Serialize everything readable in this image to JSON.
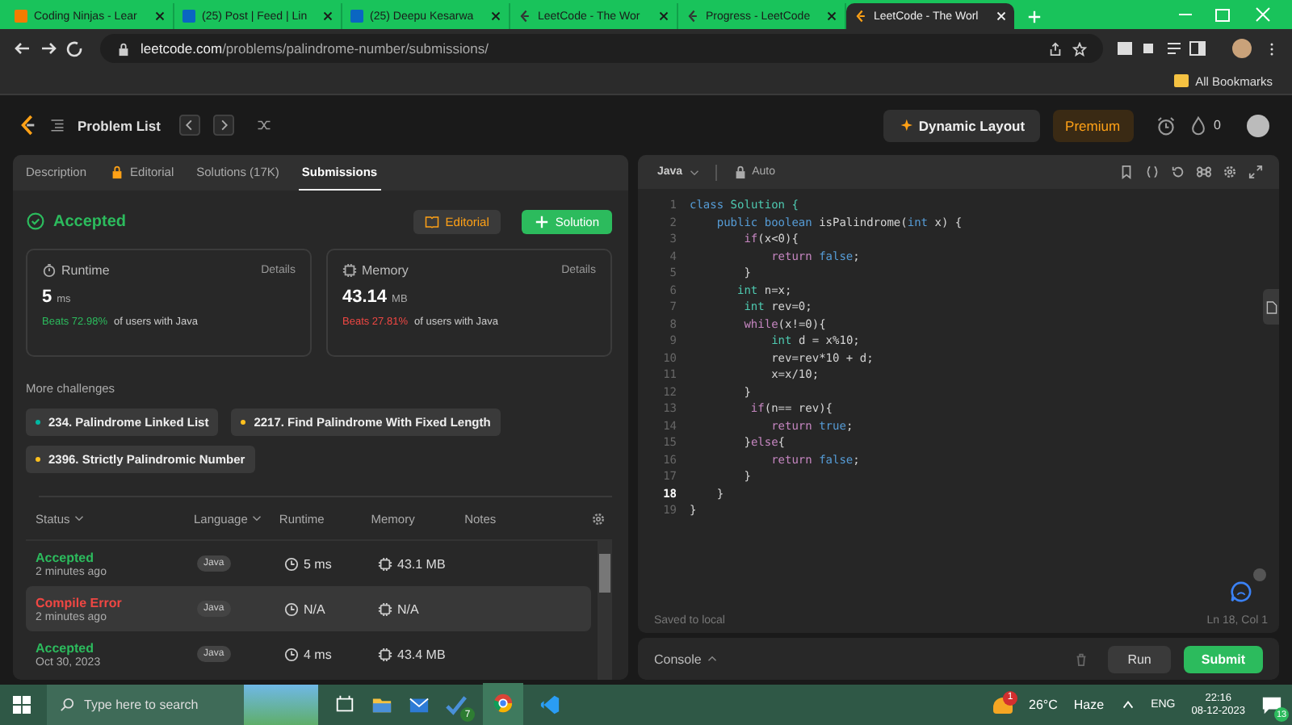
{
  "browser": {
    "tabs": [
      {
        "title": "Coding Ninjas - Lear",
        "kind": "ninja",
        "selected": false
      },
      {
        "title": "(25) Post | Feed | Lin",
        "kind": "linkedin",
        "selected": false
      },
      {
        "title": "(25) Deepu Kesarwa",
        "kind": "linkedin",
        "selected": false
      },
      {
        "title": "LeetCode - The Wor",
        "kind": "leetcode",
        "selected": false
      },
      {
        "title": "Progress - LeetCode",
        "kind": "leetcode",
        "selected": false
      },
      {
        "title": "LeetCode - The Worl",
        "kind": "leetcode",
        "selected": true
      }
    ],
    "url_host": "leetcode.com",
    "url_path": "/problems/palindrome-number/submissions/",
    "bookmarks": "All Bookmarks"
  },
  "header": {
    "problem_list": "Problem List",
    "dynamic_layout": "Dynamic Layout",
    "premium": "Premium",
    "streak": "0"
  },
  "left_tabs": [
    {
      "label": "Description",
      "selected": false
    },
    {
      "label": "Editorial",
      "selected": false
    },
    {
      "label": "Solutions (17K)",
      "selected": false
    },
    {
      "label": "Submissions",
      "selected": true
    }
  ],
  "result": {
    "status": "Accepted",
    "editorial_button": "Editorial",
    "solution_button": "Solution"
  },
  "stats": [
    {
      "title": "Runtime",
      "details": "Details",
      "value": "5",
      "unit": "ms",
      "beats": "Beats 72.98%",
      "kind": "good",
      "suffix": "of users with Java"
    },
    {
      "title": "Memory",
      "details": "Details",
      "value": "43.14",
      "unit": "MB",
      "beats": "Beats 27.81%",
      "kind": "poor",
      "suffix": "of users with Java"
    }
  ],
  "more_challenges": {
    "title": "More challenges",
    "items": [
      {
        "label": "234. Palindrome Linked List",
        "color": "#00b8a3"
      },
      {
        "label": "2217. Find Palindrome With Fixed Length",
        "color": "#ffc01e"
      },
      {
        "label": "2396. Strictly Palindromic Number",
        "color": "#ffc01e"
      }
    ]
  },
  "table": {
    "columns": [
      "Status",
      "Language",
      "Runtime",
      "Memory",
      "Notes"
    ],
    "rows": [
      {
        "status": "Accepted",
        "kind": "accepted",
        "time": "2 minutes ago",
        "language": "Java",
        "runtime": "5 ms",
        "memory": "43.1 MB",
        "selected": false
      },
      {
        "status": "Compile Error",
        "kind": "error",
        "time": "2 minutes ago",
        "language": "Java",
        "runtime": "N/A",
        "memory": "N/A",
        "selected": true
      },
      {
        "status": "Accepted",
        "kind": "accepted",
        "time": "Oct 30, 2023",
        "language": "Java",
        "runtime": "4 ms",
        "memory": "43.4 MB",
        "selected": false
      }
    ]
  },
  "editor": {
    "language": "Java",
    "mode": "Auto",
    "code": [
      {
        "number": "1",
        "selected": false,
        "tokens": [
          {
            "text": "class ",
            "kind": "keyword"
          },
          {
            "text": "Solution {",
            "kind": "type"
          }
        ]
      },
      {
        "number": "2",
        "selected": false,
        "tokens": [
          {
            "text": "    public ",
            "kind": "keyword"
          },
          {
            "text": "boolean ",
            "kind": "keyword"
          },
          {
            "text": "isPalindrome(",
            "kind": "plain"
          },
          {
            "text": "int ",
            "kind": "keyword"
          },
          {
            "text": "x) {",
            "kind": "plain"
          }
        ]
      },
      {
        "number": "3",
        "selected": false,
        "tokens": [
          {
            "text": "        if",
            "kind": "control"
          },
          {
            "text": "(x<0){",
            "kind": "plain"
          }
        ]
      },
      {
        "number": "4",
        "selected": false,
        "tokens": [
          {
            "text": "            return ",
            "kind": "control"
          },
          {
            "text": "false",
            "kind": "keyword"
          },
          {
            "text": ";",
            "kind": "plain"
          }
        ]
      },
      {
        "number": "5",
        "selected": false,
        "tokens": [
          {
            "text": "        }",
            "kind": "plain"
          }
        ]
      },
      {
        "number": "6",
        "selected": false,
        "tokens": [
          {
            "text": "       int ",
            "kind": "type"
          },
          {
            "text": "n=x;",
            "kind": "plain"
          }
        ]
      },
      {
        "number": "7",
        "selected": false,
        "tokens": [
          {
            "text": "        int ",
            "kind": "type"
          },
          {
            "text": "rev=0;",
            "kind": "plain"
          }
        ]
      },
      {
        "number": "8",
        "selected": false,
        "tokens": [
          {
            "text": "        while",
            "kind": "control"
          },
          {
            "text": "(x!=0){",
            "kind": "plain"
          }
        ]
      },
      {
        "number": "9",
        "selected": false,
        "tokens": [
          {
            "text": "            int ",
            "kind": "type"
          },
          {
            "text": "d = x%10;",
            "kind": "plain"
          }
        ]
      },
      {
        "number": "10",
        "selected": false,
        "tokens": [
          {
            "text": "            rev=rev*10 + d;",
            "kind": "plain"
          }
        ]
      },
      {
        "number": "11",
        "selected": false,
        "tokens": [
          {
            "text": "            x=x/10;",
            "kind": "plain"
          }
        ]
      },
      {
        "number": "12",
        "selected": false,
        "tokens": [
          {
            "text": "        }",
            "kind": "plain"
          }
        ]
      },
      {
        "number": "13",
        "selected": false,
        "tokens": [
          {
            "text": "         if",
            "kind": "control"
          },
          {
            "text": "(n== rev){",
            "kind": "plain"
          }
        ]
      },
      {
        "number": "14",
        "selected": false,
        "tokens": [
          {
            "text": "            return ",
            "kind": "control"
          },
          {
            "text": "true",
            "kind": "keyword"
          },
          {
            "text": ";",
            "kind": "plain"
          }
        ]
      },
      {
        "number": "15",
        "selected": false,
        "tokens": [
          {
            "text": "        }",
            "kind": "plain"
          },
          {
            "text": "else",
            "kind": "control"
          },
          {
            "text": "{",
            "kind": "plain"
          }
        ]
      },
      {
        "number": "16",
        "selected": false,
        "tokens": [
          {
            "text": "            return ",
            "kind": "control"
          },
          {
            "text": "false",
            "kind": "keyword"
          },
          {
            "text": ";",
            "kind": "plain"
          }
        ]
      },
      {
        "number": "17",
        "selected": false,
        "tokens": [
          {
            "text": "        }",
            "kind": "plain"
          }
        ]
      },
      {
        "number": "18",
        "selected": true,
        "tokens": [
          {
            "text": "    }",
            "kind": "plain"
          }
        ]
      },
      {
        "number": "19",
        "selected": false,
        "tokens": [
          {
            "text": "}",
            "kind": "plain"
          }
        ]
      }
    ],
    "saved": "Saved to local",
    "position": "Ln 18, Col 1"
  },
  "console": {
    "label": "Console",
    "run": "Run",
    "submit": "Submit"
  },
  "taskbar": {
    "search_placeholder": "Type here to search",
    "tasks_badge": "7",
    "weather_badge": "1",
    "temperature": "26°C",
    "weather": "Haze",
    "language": "ENG",
    "time": "22:16",
    "date": "08-12-2023",
    "notifications": "13"
  }
}
